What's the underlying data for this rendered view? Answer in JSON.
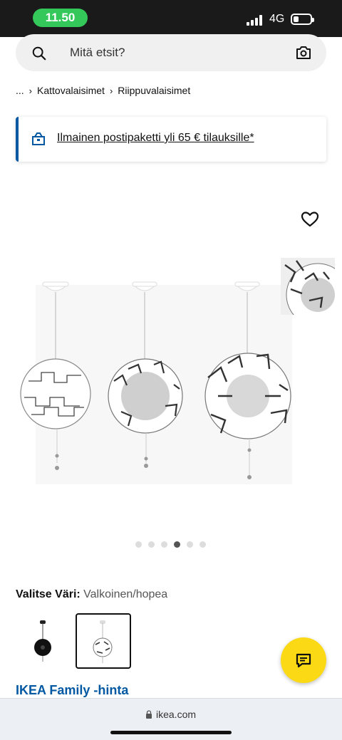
{
  "status_bar": {
    "time": "11.50",
    "network": "4G",
    "battery_level": 0.3
  },
  "search": {
    "placeholder": "Mitä etsit?"
  },
  "breadcrumb": {
    "ellipsis": "...",
    "items": [
      "Kattovalaisimet",
      "Riippuvalaisimet"
    ]
  },
  "banner": {
    "text": "Ilmainen postipaketti yli 65 € tilauksille*"
  },
  "gallery": {
    "dot_count": 6,
    "active_dot": 4
  },
  "color_select": {
    "label": "Valitse Väri:",
    "value": "Valkoinen/hopea"
  },
  "family_price": "IKEA Family -hinta",
  "browser": {
    "url": "ikea.com"
  },
  "colors": {
    "ikea_blue": "#0058a3",
    "ikea_yellow": "#fbd914",
    "status_green": "#34c759"
  },
  "icons": [
    "search-icon",
    "camera-icon",
    "truck-box-icon",
    "heart-icon",
    "chat-icon",
    "lock-icon"
  ]
}
